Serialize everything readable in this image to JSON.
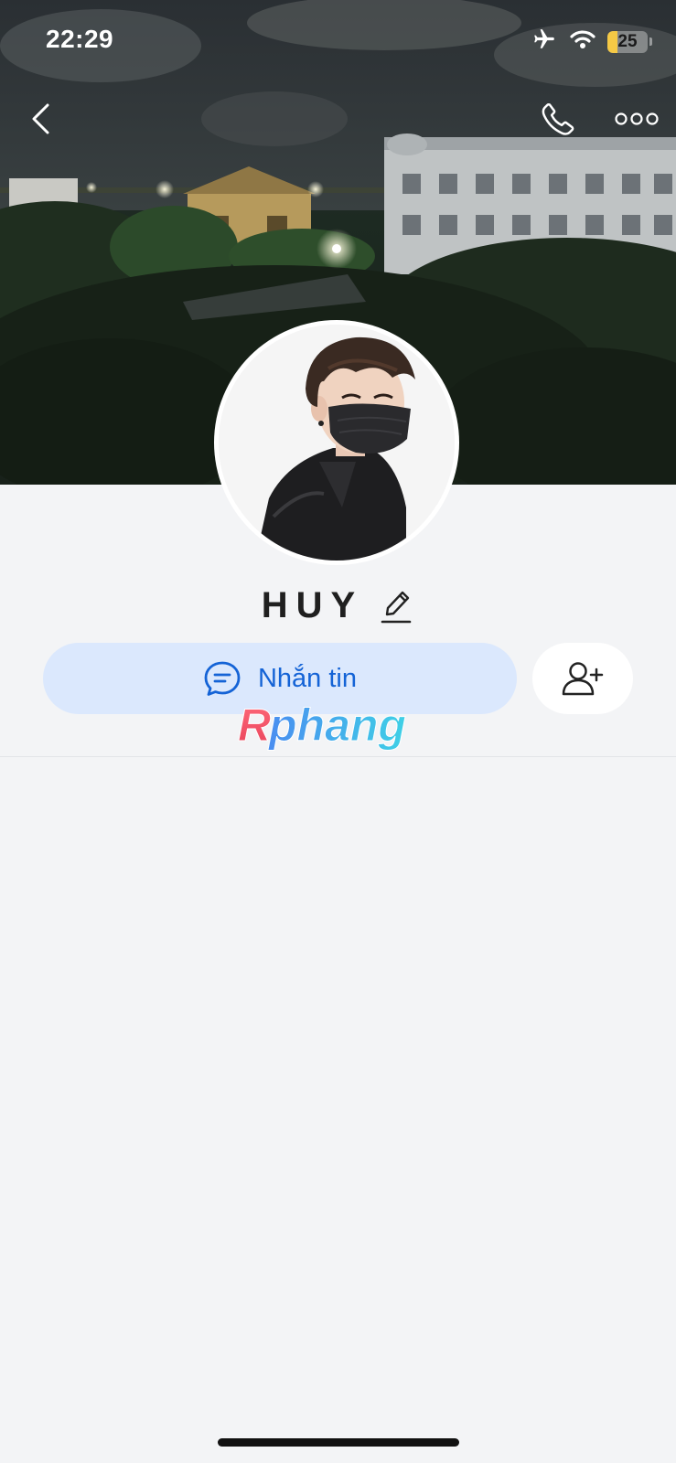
{
  "status_bar": {
    "time": "22:29",
    "battery_level": "25",
    "airplane_mode": true,
    "wifi": true,
    "icons": [
      "airplane-icon",
      "wifi-icon",
      "battery-icon"
    ]
  },
  "nav": {
    "icons": [
      "back-arrow-icon",
      "phone-icon",
      "more-icon"
    ]
  },
  "profile": {
    "name": "HUY",
    "edit_icon": "pencil-icon"
  },
  "actions": {
    "message_label": "Nhắn tin",
    "message_icon": "chat-bubble-icon",
    "add_friend_icon": "add-friend-icon"
  },
  "watermark": {
    "text": "Rphang"
  },
  "colors": {
    "accent": "#1463d6",
    "message_button_bg": "#dbe8fd",
    "page_bg": "#f3f4f6",
    "battery_fill": "#f5c945"
  }
}
